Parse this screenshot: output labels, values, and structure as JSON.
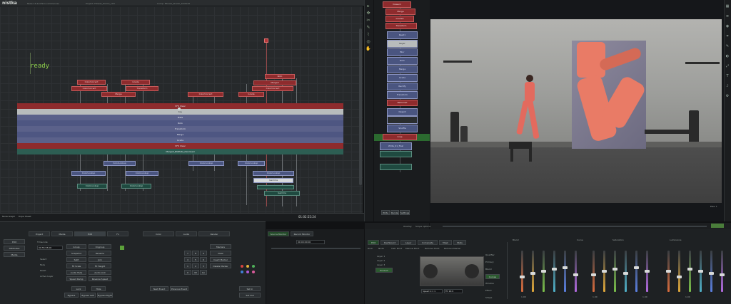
{
  "app": {
    "brand": "nistka",
    "top_info": [
      "Nuke 13.2v4 Non-commercial",
      "Project: Fitness_Promo_v03",
      "Comp: Fitness_Studio_Shot010"
    ]
  },
  "colors": {
    "accent_green": "#8dcf4a",
    "node_red": "#8e2b2d",
    "node_blue": "#4a5580",
    "node_green": "#1f4a40"
  },
  "timeline": {
    "status": "ready",
    "bands": [
      "VFX Clear",
      "Key",
      "Plate",
      "Roto",
      "Transform",
      "Merge",
      "Grade",
      "VFX Clear",
      "Merge3_BGPlate_Denoised"
    ],
    "top_nodes": [
      "ColorCorrect",
      "ColorCorrect",
      "Grade",
      "Transform",
      "Merge",
      "ColorCorrect",
      "Grade",
      "Roto",
      "Merge2",
      "ColorCorrect"
    ],
    "bottom_nodes": [
      "ColorLookup",
      "ColorLookup",
      "ColorLookup",
      "ColorLookup",
      "ColorLookup",
      "ColorLookup",
      "ColorLookup",
      "ColorLookup",
      "Gamma",
      "Gamma"
    ],
    "ruler_labels": [
      "Node Graph",
      "Dope Sheet"
    ],
    "timecode": "01:02:55:24"
  },
  "nodelist": {
    "red_items": [
      "Viewer1",
      "Merge",
      "Grade4",
      "Transform"
    ],
    "blue_items": [
      "Read1",
      "Keyer",
      "Blur",
      "Roto",
      "Merge",
      "Grade",
      "Rectify",
      "Transform",
      "Reformat",
      "Despill",
      "Shuffle",
      "Crop",
      "Write_01_final"
    ],
    "buttons": [
      "Write",
      "Render",
      "Settings"
    ]
  },
  "viewer": {
    "label": "Prev ↓",
    "transport_labels": [
      "Overlay",
      "Scope options"
    ]
  },
  "panel_left": {
    "tabs": [
      "Project",
      "Media",
      "Edit",
      "Fx",
      "Color",
      "Audio",
      "Render"
    ],
    "sidebar": [
      "Edit",
      "Attributes",
      "Media"
    ],
    "timecode": "00:55:55:00",
    "fields_a": [
      "Group",
      "Snapshot",
      "Split",
      "Fit Scale",
      "Audio Fade",
      "Speed Ramp"
    ],
    "fields_b": [
      "Ungroup",
      "Rename",
      "Join",
      "Fit Height",
      "Audio Link",
      "Reverse Speed"
    ],
    "checks": [
      "Select",
      "Fade",
      "Reset",
      "Active Layer"
    ],
    "numpad": [
      "7",
      "8",
      "9",
      "4",
      "5",
      "6",
      "1",
      "2",
      "3",
      "0",
      "00",
      "Go"
    ],
    "bottom_btns": [
      "Lock",
      "Hide",
      "Bypass",
      "Bypass Left",
      "Bypass Right"
    ],
    "timecode_label": "Timecode",
    "recorder": "Record Monitor",
    "source": "Source Monitor",
    "tc_field": "00:00:00:00",
    "right_btns": [
      "Markers",
      "Clear",
      "Insert Marker",
      "Delete Marker",
      "Set In",
      "Set Out",
      "Next Event",
      "Previous Event"
    ]
  },
  "panel_right": {
    "tabs": [
      "Edit",
      "Dashboard",
      "Layer",
      "Composite",
      "Mask",
      "Stats"
    ],
    "subtabs": [
      "Rndr",
      "Node",
      "Instr Point",
      "Manual Point",
      "Remove Point",
      "Remove Marker"
    ],
    "list": [
      "Layer 1",
      "Layer 2",
      "Layer 3",
      "Product"
    ],
    "props": [
      "Qualifier",
      "Primary",
      "Blend",
      "Curves",
      "Window",
      "Effect",
      "Shape"
    ],
    "speed": "Speed 1:1 1",
    "zoom": "Fit 16:9",
    "sections": [
      "Blend",
      "Curve",
      "Saturation",
      "Luminance"
    ],
    "slider_groups": [
      {
        "name": "Lift",
        "values": [
          0.35,
          0.45,
          0.5,
          0.55,
          0.6,
          0.4
        ]
      },
      {
        "name": "Gamma",
        "values": [
          0.4,
          0.5,
          0.55,
          0.45,
          0.6,
          0.5
        ]
      },
      {
        "name": "Gain",
        "values": [
          0.5,
          0.35,
          0.55,
          0.5,
          0.45,
          0.4
        ]
      }
    ],
    "readouts": [
      "1.00",
      "1.00",
      "1.00",
      "1.00"
    ]
  }
}
